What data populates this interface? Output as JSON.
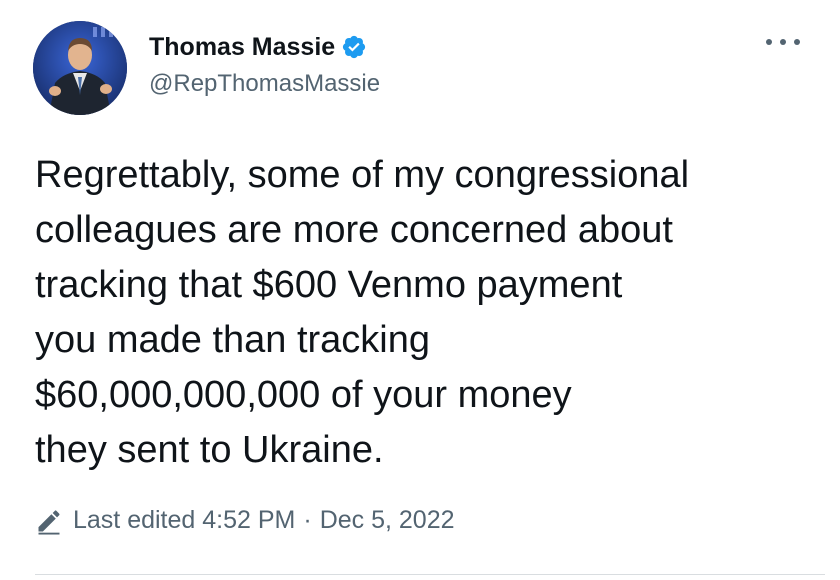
{
  "author": {
    "display_name": "Thomas Massie",
    "handle": "@RepThomasMassie",
    "verified": true
  },
  "tweet": {
    "text": "Regrettably, some of my congressional\ncolleagues are more concerned about\ntracking that $600 Venmo payment\nyou made than tracking\n$60,000,000,000 of your money\nthey sent to Ukraine."
  },
  "meta": {
    "edited_label": "Last edited 4:52 PM",
    "separator": "·",
    "date": "Dec 5, 2022"
  },
  "icons": {
    "verified": "verified-badge-icon",
    "more": "more-options-icon",
    "edit": "pencil-icon"
  },
  "colors": {
    "verified_blue": "#1d9bf0",
    "secondary_text": "#536471",
    "primary_text": "#0f1419"
  }
}
